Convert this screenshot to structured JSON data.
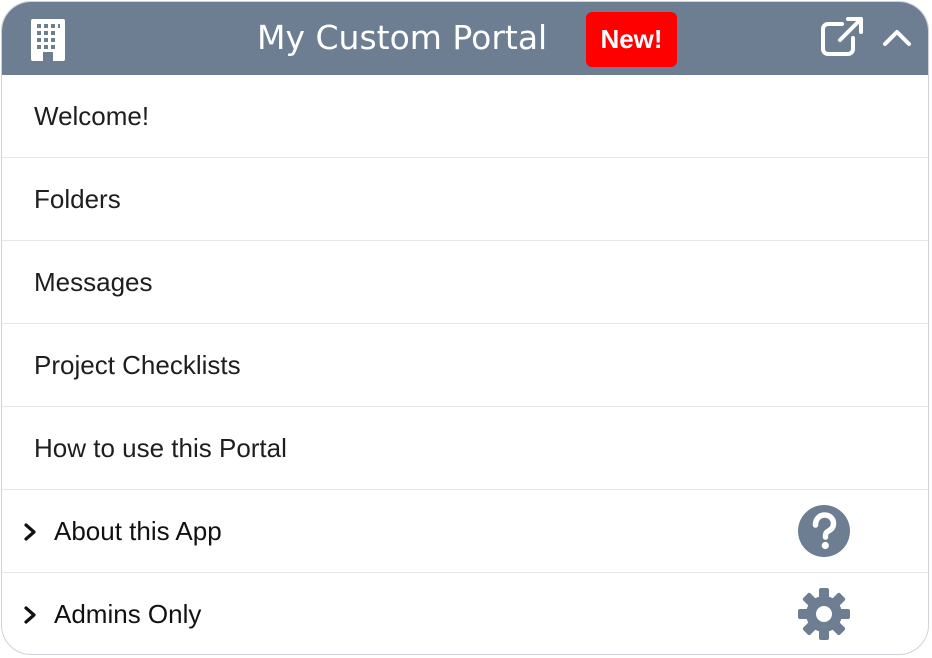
{
  "header": {
    "title": "My Custom Portal",
    "badge": "New!",
    "icons": {
      "left": "building-icon",
      "external": "external-link-icon",
      "collapse": "chevron-up-icon"
    },
    "background_color": "#6e7e92",
    "badge_color": "#ff0000"
  },
  "menu": {
    "items": [
      {
        "label": "Welcome!"
      },
      {
        "label": "Folders"
      },
      {
        "label": "Messages"
      },
      {
        "label": "Project Checklists"
      },
      {
        "label": "How to use this Portal"
      },
      {
        "label": "About this App",
        "expandable": true,
        "icon": "question-circle-icon"
      },
      {
        "label": "Admins Only",
        "expandable": true,
        "icon": "gear-icon"
      }
    ]
  },
  "colors": {
    "icon_gray": "#6e7e92",
    "text": "#1e1e1e",
    "divider": "#e5e7ea"
  }
}
